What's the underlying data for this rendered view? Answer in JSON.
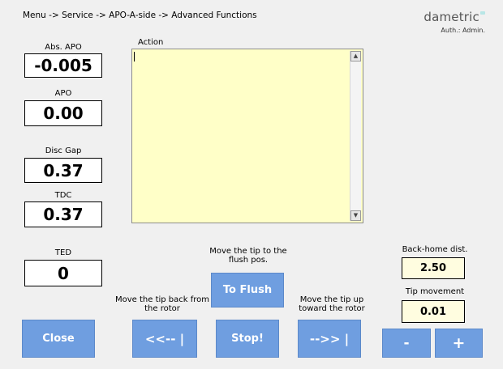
{
  "header": {
    "breadcrumb": "Menu -> Service -> APO-A-side -> Advanced Functions",
    "brand": "dametric",
    "auth": "Auth.: Admin."
  },
  "readouts": {
    "abs_apo": {
      "label": "Abs. APO",
      "value": "-0.005"
    },
    "apo": {
      "label": "APO",
      "value": "0.00"
    },
    "disc_gap": {
      "label": "Disc Gap",
      "value": "0.37"
    },
    "tdc": {
      "label": "TDC",
      "value": "0.37"
    },
    "ted": {
      "label": "TED",
      "value": "0"
    }
  },
  "action": {
    "label": "Action",
    "text": ""
  },
  "settings": {
    "back_home": {
      "label": "Back-home dist.",
      "value": "2.50"
    },
    "tip_movement": {
      "label": "Tip movement",
      "value": "0.01"
    }
  },
  "captions": {
    "flush": "Move the tip to the flush pos.",
    "back": "Move the tip back from the rotor",
    "toward": "Move the tip up toward the rotor"
  },
  "buttons": {
    "to_flush": "To Flush",
    "close": "Close",
    "back": "<<-- |",
    "stop": "Stop!",
    "forward": "-->> |",
    "minus": "-",
    "plus": "+"
  },
  "colors": {
    "button": "#6f9ee0",
    "action_bg": "#ffffc8",
    "setting_bg": "#fffde0"
  }
}
